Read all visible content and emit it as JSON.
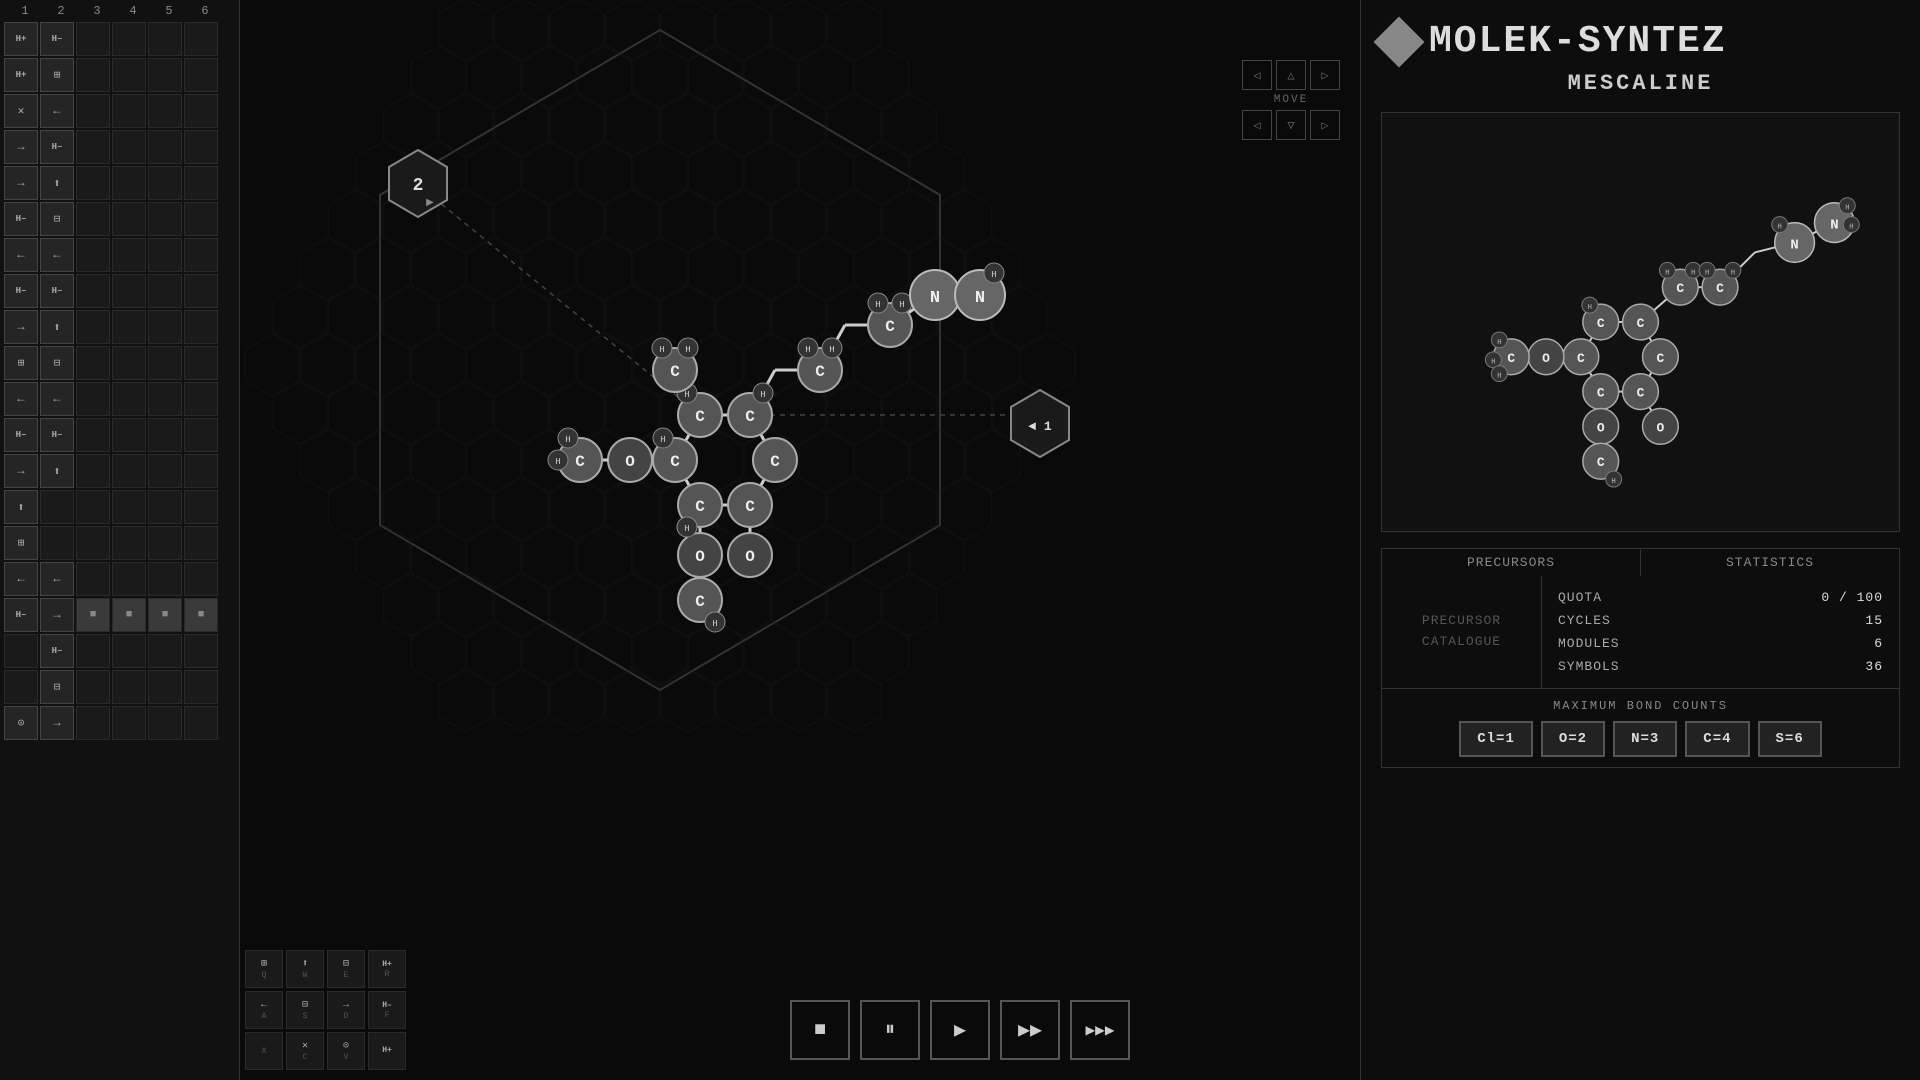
{
  "app": {
    "title": "MOLEK-SYNTEZ",
    "molecule_name": "MESCALINE"
  },
  "left_panel": {
    "col_headers": [
      "1",
      "2",
      "3",
      "4",
      "5",
      "6"
    ],
    "rows": [
      [
        {
          "icon": "H+",
          "type": "text"
        },
        {
          "icon": "H–",
          "type": "text"
        },
        {
          "icon": "",
          "type": "empty"
        },
        {
          "icon": "",
          "type": "empty"
        },
        {
          "icon": "",
          "type": "empty"
        },
        {
          "icon": "",
          "type": "empty"
        }
      ],
      [
        {
          "icon": "H+",
          "type": "text"
        },
        {
          "icon": "⊞",
          "type": "sym"
        },
        {
          "icon": "",
          "type": "empty"
        },
        {
          "icon": "",
          "type": "empty"
        },
        {
          "icon": "",
          "type": "empty"
        },
        {
          "icon": "",
          "type": "empty"
        }
      ],
      [
        {
          "icon": "✕",
          "type": "text"
        },
        {
          "icon": "←",
          "type": "arr"
        },
        {
          "icon": "",
          "type": "empty"
        },
        {
          "icon": "",
          "type": "empty"
        },
        {
          "icon": "",
          "type": "empty"
        },
        {
          "icon": "",
          "type": "empty"
        }
      ],
      [
        {
          "icon": "→",
          "type": "arr"
        },
        {
          "icon": "H–",
          "type": "text"
        },
        {
          "icon": "",
          "type": "empty"
        },
        {
          "icon": "",
          "type": "empty"
        },
        {
          "icon": "",
          "type": "empty"
        },
        {
          "icon": "",
          "type": "empty"
        }
      ],
      [
        {
          "icon": "→",
          "type": "arr"
        },
        {
          "icon": "⬆",
          "type": "arr"
        },
        {
          "icon": "",
          "type": "empty"
        },
        {
          "icon": "",
          "type": "empty"
        },
        {
          "icon": "",
          "type": "empty"
        },
        {
          "icon": "",
          "type": "empty"
        }
      ],
      [
        {
          "icon": "H–",
          "type": "text"
        },
        {
          "icon": "⊟",
          "type": "sym"
        },
        {
          "icon": "",
          "type": "empty"
        },
        {
          "icon": "",
          "type": "empty"
        },
        {
          "icon": "",
          "type": "empty"
        },
        {
          "icon": "",
          "type": "empty"
        }
      ],
      [
        {
          "icon": "←",
          "type": "arr"
        },
        {
          "icon": "←",
          "type": "arr"
        },
        {
          "icon": "",
          "type": "empty"
        },
        {
          "icon": "",
          "type": "empty"
        },
        {
          "icon": "",
          "type": "empty"
        },
        {
          "icon": "",
          "type": "empty"
        }
      ],
      [
        {
          "icon": "H–",
          "type": "text"
        },
        {
          "icon": "H–",
          "type": "text"
        },
        {
          "icon": "",
          "type": "empty"
        },
        {
          "icon": "",
          "type": "empty"
        },
        {
          "icon": "",
          "type": "empty"
        },
        {
          "icon": "",
          "type": "empty"
        }
      ],
      [
        {
          "icon": "→",
          "type": "arr"
        },
        {
          "icon": "⬆",
          "type": "arr"
        },
        {
          "icon": "",
          "type": "empty"
        },
        {
          "icon": "",
          "type": "empty"
        },
        {
          "icon": "",
          "type": "empty"
        },
        {
          "icon": "",
          "type": "empty"
        }
      ],
      [
        {
          "icon": "⊞",
          "type": "sym"
        },
        {
          "icon": "⊟",
          "type": "sym"
        },
        {
          "icon": "",
          "type": "empty"
        },
        {
          "icon": "",
          "type": "empty"
        },
        {
          "icon": "",
          "type": "empty"
        },
        {
          "icon": "",
          "type": "empty"
        }
      ],
      [
        {
          "icon": "←",
          "type": "arr"
        },
        {
          "icon": "←",
          "type": "arr"
        },
        {
          "icon": "",
          "type": "empty"
        },
        {
          "icon": "",
          "type": "empty"
        },
        {
          "icon": "",
          "type": "empty"
        },
        {
          "icon": "",
          "type": "empty"
        }
      ],
      [
        {
          "icon": "H–",
          "type": "text"
        },
        {
          "icon": "H–",
          "type": "text"
        },
        {
          "icon": "",
          "type": "empty"
        },
        {
          "icon": "",
          "type": "empty"
        },
        {
          "icon": "",
          "type": "empty"
        },
        {
          "icon": "",
          "type": "empty"
        }
      ],
      [
        {
          "icon": "→",
          "type": "arr"
        },
        {
          "icon": "⬆",
          "type": "arr"
        },
        {
          "icon": "",
          "type": "empty"
        },
        {
          "icon": "",
          "type": "empty"
        },
        {
          "icon": "",
          "type": "empty"
        },
        {
          "icon": "",
          "type": "empty"
        }
      ],
      [
        {
          "icon": "⬆",
          "type": "arr"
        },
        {
          "icon": "",
          "type": "empty"
        },
        {
          "icon": "",
          "type": "empty"
        },
        {
          "icon": "",
          "type": "empty"
        },
        {
          "icon": "",
          "type": "empty"
        },
        {
          "icon": "",
          "type": "empty"
        }
      ],
      [
        {
          "icon": "⊞",
          "type": "sym"
        },
        {
          "icon": "",
          "type": "empty"
        },
        {
          "icon": "",
          "type": "empty"
        },
        {
          "icon": "",
          "type": "empty"
        },
        {
          "icon": "",
          "type": "empty"
        },
        {
          "icon": "",
          "type": "empty"
        }
      ],
      [
        {
          "icon": "←",
          "type": "arr"
        },
        {
          "icon": "←",
          "type": "arr"
        },
        {
          "icon": "",
          "type": "empty"
        },
        {
          "icon": "",
          "type": "empty"
        },
        {
          "icon": "",
          "type": "empty"
        },
        {
          "icon": "",
          "type": "empty"
        }
      ],
      [
        {
          "icon": "H–",
          "type": "text"
        },
        {
          "icon": "→",
          "type": "arr"
        },
        {
          "icon": "■",
          "type": "gray"
        },
        {
          "icon": "■",
          "type": "gray"
        },
        {
          "icon": "■",
          "type": "gray"
        },
        {
          "icon": "■",
          "type": "gray"
        }
      ],
      [
        {
          "icon": "",
          "type": "empty"
        },
        {
          "icon": "H–",
          "type": "text"
        },
        {
          "icon": "",
          "type": "empty"
        },
        {
          "icon": "",
          "type": "empty"
        },
        {
          "icon": "",
          "type": "empty"
        },
        {
          "icon": "",
          "type": "empty"
        }
      ],
      [
        {
          "icon": "",
          "type": "empty"
        },
        {
          "icon": "⊟",
          "type": "sym"
        },
        {
          "icon": "",
          "type": "empty"
        },
        {
          "icon": "",
          "type": "empty"
        },
        {
          "icon": "",
          "type": "empty"
        },
        {
          "icon": "",
          "type": "empty"
        }
      ],
      [
        {
          "icon": "⊙",
          "type": "sym"
        },
        {
          "icon": "→",
          "type": "arr"
        },
        {
          "icon": "",
          "type": "empty"
        },
        {
          "icon": "",
          "type": "empty"
        },
        {
          "icon": "",
          "type": "empty"
        },
        {
          "icon": "",
          "type": "empty"
        }
      ]
    ]
  },
  "keyboard": {
    "rows": [
      [
        {
          "icon": "⊞",
          "key": "Q"
        },
        {
          "icon": "⬆",
          "key": "W"
        },
        {
          "icon": "⊟",
          "key": "E"
        },
        {
          "icon": "H+",
          "key": "R"
        }
      ],
      [
        {
          "icon": "←",
          "key": "A"
        },
        {
          "icon": "⊟",
          "key": "S"
        },
        {
          "icon": "→",
          "key": "D"
        },
        {
          "icon": "H–",
          "key": "F"
        }
      ],
      [
        {
          "icon": "",
          "key": "X"
        },
        {
          "icon": "✕",
          "key": "C"
        },
        {
          "icon": "⊙",
          "key": "V"
        },
        {
          "icon": "H+",
          "key": ""
        }
      ]
    ]
  },
  "playback": {
    "stop_label": "■",
    "pause_label": "⏸",
    "play_label": "▶",
    "fast_label": "▶▶",
    "skip_label": "▶▶▶"
  },
  "move_controls": {
    "label": "MOVE"
  },
  "stats": {
    "precursors_header": "PRECURSORS",
    "statistics_header": "STATISTICS",
    "precursor_catalogue": "PRECURSOR\nCATALOGUE",
    "quota_label": "QUOTA",
    "quota_value": "0 / 100",
    "cycles_label": "CYCLES",
    "cycles_value": "15",
    "modules_label": "MODULES",
    "modules_value": "6",
    "symbols_label": "SYMBOLS",
    "symbols_value": "36"
  },
  "bond_counts": {
    "title": "MAXIMUM BOND COUNTS",
    "items": [
      {
        "label": "Cl=1"
      },
      {
        "label": "O=2"
      },
      {
        "label": "N=3"
      },
      {
        "label": "C=4"
      },
      {
        "label": "S=6"
      }
    ]
  },
  "markers": {
    "hex2_label": "2",
    "hex1_label": "◄ 1"
  }
}
